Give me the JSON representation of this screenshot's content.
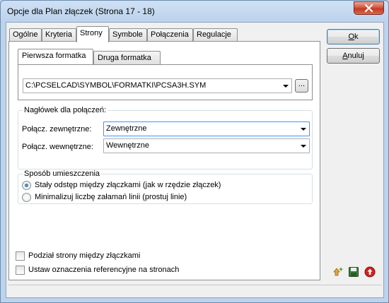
{
  "window": {
    "title": "Opcje dla Plan złączek  (Strona 17 - 18)"
  },
  "tabs": [
    {
      "label": "Ogólne"
    },
    {
      "label": "Kryteria"
    },
    {
      "label": "Strony",
      "active": true
    },
    {
      "label": "Symbole"
    },
    {
      "label": "Połączenia"
    },
    {
      "label": "Regulacje"
    }
  ],
  "formatka": {
    "tabs": [
      {
        "label": "Pierwsza formatka",
        "active": true
      },
      {
        "label": "Druga formatka"
      }
    ],
    "path_value": "C:\\PCSELCAD\\SYMBOL\\FORMATKI\\PCSA3H.SYM",
    "browse_label": "..."
  },
  "header_group": {
    "title": "Nagłówek dla połączeń:",
    "external_label": "Połącz. zewnętrzne:",
    "external_value": "Zewnętrzne",
    "internal_label": "Połącz. wewnętrzne:",
    "internal_value": "Wewnętrzne"
  },
  "placement_group": {
    "title": "Sposób umieszczenia",
    "options": [
      {
        "label": "Stały odstęp między złączkami (jak w rzędzie złączek)",
        "checked": true
      },
      {
        "label": "Minimalizuj liczbę załamań linii (prostuj linie)",
        "checked": false
      }
    ]
  },
  "checkboxes": [
    {
      "label": "Podział strony między złączkami",
      "checked": false
    },
    {
      "label": "Ustaw oznaczenia referencyjne na stronach",
      "checked": false
    }
  ],
  "buttons": {
    "ok": {
      "underline": "O",
      "rest": "k"
    },
    "cancel": {
      "underline": "A",
      "rest": "nuluj"
    }
  },
  "icons": [
    "export-icon",
    "save-icon",
    "upload-icon"
  ],
  "colors": {
    "accent": "#3399ff",
    "radio_fill": "#1d5e9a",
    "close_button": "#c23a22"
  }
}
